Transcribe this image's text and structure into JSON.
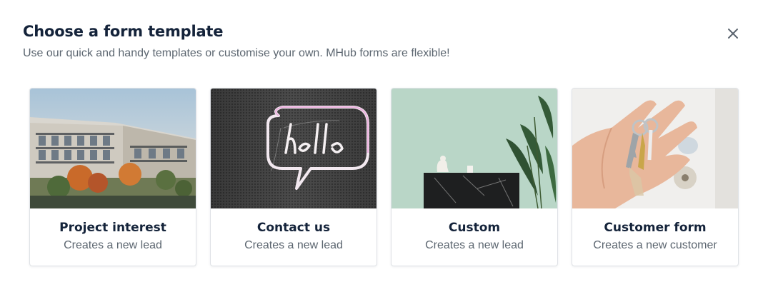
{
  "modal": {
    "title": "Choose a form template",
    "subtitle": "Use our quick and handy templates or customise your own. MHub forms are flexible!",
    "close_icon": "close-icon"
  },
  "templates": [
    {
      "title": "Project interest",
      "description": "Creates a new lead",
      "image": "apartment-building-photo"
    },
    {
      "title": "Contact us",
      "description": "Creates a new lead",
      "image": "hello-neon-sign-photo"
    },
    {
      "title": "Custom",
      "description": "Creates a new lead",
      "image": "plant-and-cabinet-photo"
    },
    {
      "title": "Customer form",
      "description": "Creates a new customer",
      "image": "hand-holding-keys-photo"
    }
  ],
  "colors": {
    "title": "#14233a",
    "subtitle": "#5c6670",
    "card_border": "#dfe2e6"
  }
}
